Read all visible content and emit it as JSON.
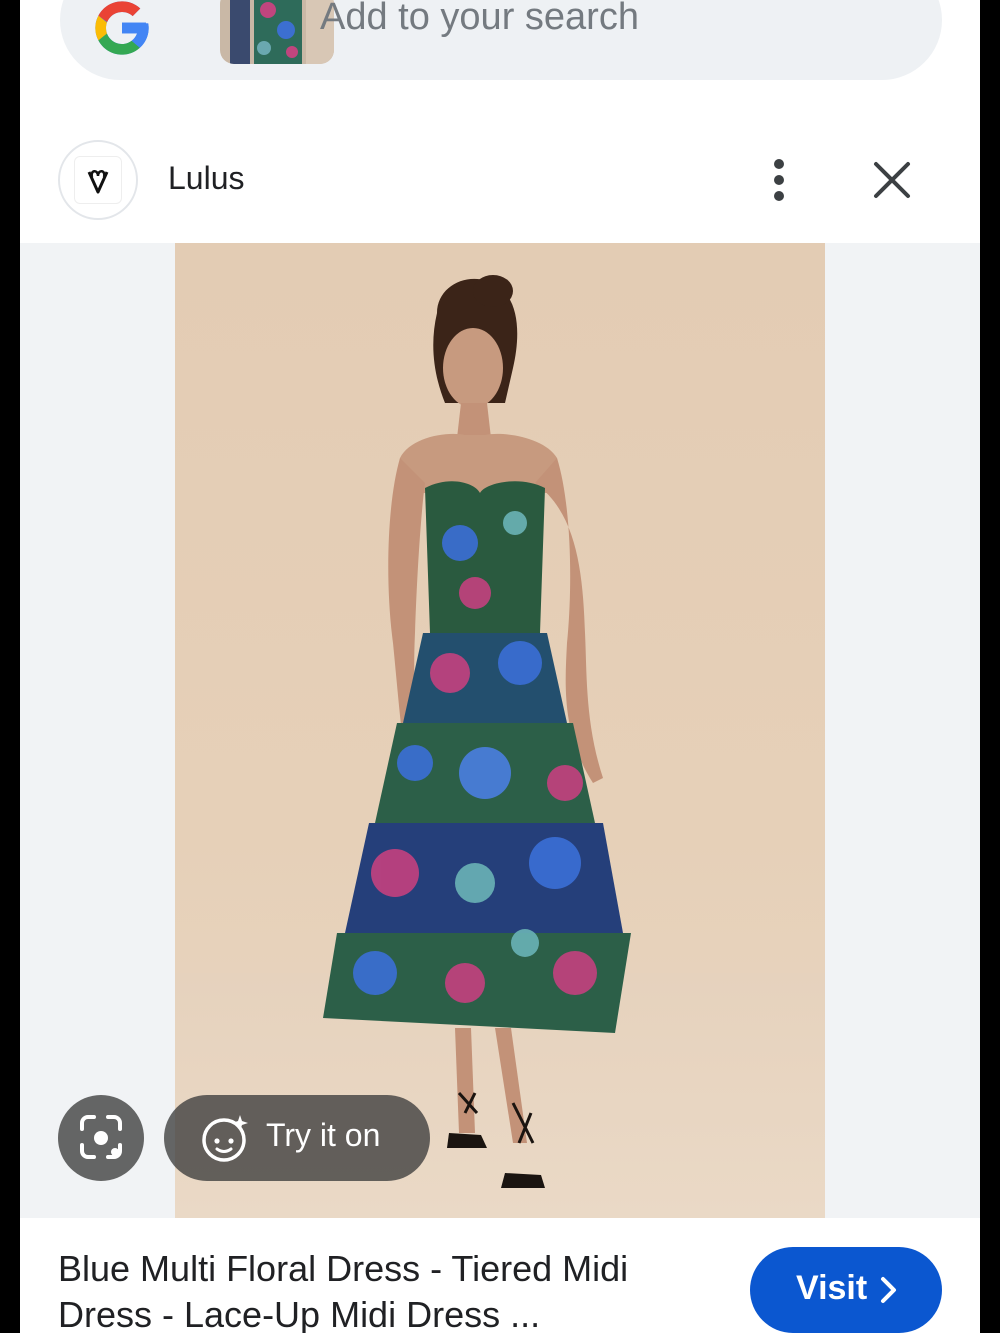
{
  "search": {
    "placeholder": "Add to your search",
    "logo_icon": "google-g-icon"
  },
  "source": {
    "name": "Lulus",
    "avatar_icon": "lulus-heart-logo-icon",
    "more_icon": "more-vert-icon",
    "close_icon": "close-icon"
  },
  "image": {
    "description_icon": "product-photo",
    "lens_icon": "google-lens-icon",
    "try_on_label": "Try it on",
    "try_on_icon": "face-sparkle-icon"
  },
  "product": {
    "title": "Blue Multi Floral Dress - Tiered Midi Dress - Lace-Up Midi Dress ..."
  },
  "visit": {
    "label": "Visit",
    "icon": "chevron-right-icon"
  },
  "colors": {
    "visit_button": "#0b57d0",
    "search_bg": "#eef1f4",
    "image_bg": "#f1f3f5"
  }
}
